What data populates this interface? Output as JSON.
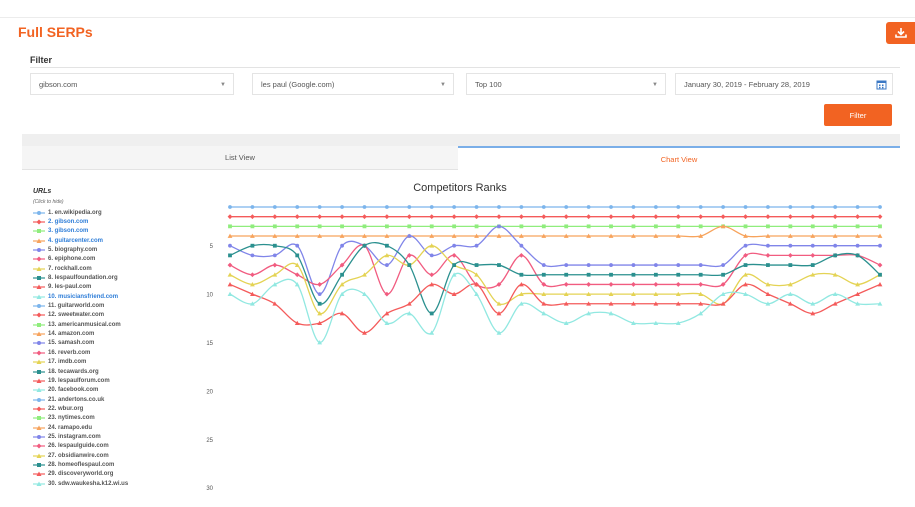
{
  "header": {
    "title": "Full SERPs"
  },
  "filter": {
    "label": "Filter",
    "domain": "gibson.com",
    "keyword": "les paul (Google.com)",
    "top": "Top 100",
    "date_range": "January 30, 2019 - February 28, 2019",
    "button": "Filter"
  },
  "tabs": {
    "list": "List View",
    "chart": "Chart View"
  },
  "legend": {
    "title": "URLs",
    "subtitle": "(Click to hide)",
    "items": [
      {
        "label": "1. en.wikipedia.org",
        "color": "#7cb5ec",
        "marker": "circle"
      },
      {
        "label": "2. gibson.com",
        "color": "#f45b5b",
        "marker": "diamond"
      },
      {
        "label": "3. gibson.com",
        "color": "#90ed7d",
        "marker": "square"
      },
      {
        "label": "4. guitarcenter.com",
        "color": "#f7a35c",
        "marker": "triangle"
      },
      {
        "label": "5. biography.com",
        "color": "#8085e9",
        "marker": "circle"
      },
      {
        "label": "6. epiphone.com",
        "color": "#f15c80",
        "marker": "diamond"
      },
      {
        "label": "7. rockhall.com",
        "color": "#e4d354",
        "marker": "triangle"
      },
      {
        "label": "8. lespaulfoundation.org",
        "color": "#2b908f",
        "marker": "square"
      },
      {
        "label": "9. les-paul.com",
        "color": "#f45b5b",
        "marker": "triangle"
      },
      {
        "label": "10. musiciansfriend.com",
        "color": "#91e8e1",
        "marker": "triangle"
      },
      {
        "label": "11. guitarworld.com",
        "color": "#7cb5ec",
        "marker": "circle"
      },
      {
        "label": "12. sweetwater.com",
        "color": "#f45b5b",
        "marker": "diamond"
      },
      {
        "label": "13. americanmusical.com",
        "color": "#90ed7d",
        "marker": "square"
      },
      {
        "label": "14. amazon.com",
        "color": "#f7a35c",
        "marker": "triangle"
      },
      {
        "label": "15. samash.com",
        "color": "#8085e9",
        "marker": "circle"
      },
      {
        "label": "16. reverb.com",
        "color": "#f15c80",
        "marker": "diamond"
      },
      {
        "label": "17. imdb.com",
        "color": "#e4d354",
        "marker": "triangle"
      },
      {
        "label": "18. tecawards.org",
        "color": "#2b908f",
        "marker": "square"
      },
      {
        "label": "19. lespaulforum.com",
        "color": "#f45b5b",
        "marker": "triangle"
      },
      {
        "label": "20. facebook.com",
        "color": "#91e8e1",
        "marker": "triangle"
      },
      {
        "label": "21. andertons.co.uk",
        "color": "#7cb5ec",
        "marker": "circle"
      },
      {
        "label": "22. wbur.org",
        "color": "#f45b5b",
        "marker": "diamond"
      },
      {
        "label": "23. nytimes.com",
        "color": "#90ed7d",
        "marker": "square"
      },
      {
        "label": "24. ramapo.edu",
        "color": "#f7a35c",
        "marker": "triangle"
      },
      {
        "label": "25. instagram.com",
        "color": "#8085e9",
        "marker": "circle"
      },
      {
        "label": "26. lespaulguide.com",
        "color": "#f15c80",
        "marker": "diamond"
      },
      {
        "label": "27. obsidianwire.com",
        "color": "#e4d354",
        "marker": "triangle"
      },
      {
        "label": "28. homeoflespaul.com",
        "color": "#2b908f",
        "marker": "square"
      },
      {
        "label": "29. discoveryworld.org",
        "color": "#f45b5b",
        "marker": "triangle"
      },
      {
        "label": "30. sdw.waukesha.k12.wi.us",
        "color": "#91e8e1",
        "marker": "triangle"
      }
    ]
  },
  "chart_data": {
    "type": "line",
    "title": "Competitors Ranks",
    "y_ticks": [
      5,
      10,
      15,
      20,
      25,
      30
    ],
    "ylim": [
      1,
      32
    ],
    "y_reversed": true,
    "point_count": 30,
    "series": [
      {
        "name": "1. en.wikipedia.org",
        "color": "#7cb5ec",
        "marker": "circle",
        "values": [
          1,
          1,
          1,
          1,
          1,
          1,
          1,
          1,
          1,
          1,
          1,
          1,
          1,
          1,
          1,
          1,
          1,
          1,
          1,
          1,
          1,
          1,
          1,
          1,
          1,
          1,
          1,
          1,
          1,
          1
        ]
      },
      {
        "name": "2. gibson.com",
        "color": "#f45b5b",
        "marker": "diamond",
        "values": [
          2,
          2,
          2,
          2,
          2,
          2,
          2,
          2,
          2,
          2,
          2,
          2,
          2,
          2,
          2,
          2,
          2,
          2,
          2,
          2,
          2,
          2,
          2,
          2,
          2,
          2,
          2,
          2,
          2,
          2
        ]
      },
      {
        "name": "3. gibson.com",
        "color": "#90ed7d",
        "marker": "square",
        "values": [
          3,
          3,
          3,
          3,
          3,
          3,
          3,
          3,
          3,
          3,
          3,
          3,
          3,
          3,
          3,
          3,
          3,
          3,
          3,
          3,
          3,
          3,
          3,
          3,
          3,
          3,
          3,
          3,
          3,
          3
        ]
      },
      {
        "name": "4. guitarcenter.com",
        "color": "#f7a35c",
        "marker": "triangle",
        "values": [
          4,
          4,
          4,
          4,
          4,
          4,
          4,
          4,
          4,
          4,
          4,
          4,
          4,
          4,
          4,
          4,
          4,
          4,
          4,
          4,
          4,
          4,
          3,
          4,
          4,
          4,
          4,
          4,
          4,
          4
        ]
      },
      {
        "name": "5. biography.com",
        "color": "#8085e9",
        "marker": "circle",
        "values": [
          5,
          6,
          6,
          5,
          10,
          5,
          5,
          7,
          4,
          6,
          5,
          5,
          3,
          5,
          7,
          7,
          7,
          7,
          7,
          7,
          7,
          7,
          7,
          5,
          5,
          5,
          5,
          5,
          5,
          5
        ]
      },
      {
        "name": "6. epiphone.com",
        "color": "#f15c80",
        "marker": "diamond",
        "values": [
          7,
          8,
          7,
          8,
          9,
          7,
          5,
          10,
          6,
          8,
          6,
          9,
          9,
          6,
          9,
          9,
          9,
          9,
          9,
          9,
          9,
          9,
          9,
          6,
          6,
          6,
          6,
          6,
          6,
          7
        ]
      },
      {
        "name": "7. rockhall.com",
        "color": "#e4d354",
        "marker": "triangle",
        "values": [
          8,
          9,
          8,
          7,
          12,
          9,
          8,
          6,
          7,
          5,
          7,
          8,
          11,
          10,
          10,
          10,
          10,
          10,
          10,
          10,
          10,
          10,
          11,
          8,
          9,
          9,
          8,
          8,
          9,
          8
        ]
      },
      {
        "name": "8. lespaulfoundation.org",
        "color": "#2b908f",
        "marker": "square",
        "values": [
          6,
          5,
          5,
          6,
          11,
          8,
          5,
          5,
          7,
          12,
          7,
          7,
          7,
          8,
          8,
          8,
          8,
          8,
          8,
          8,
          8,
          8,
          8,
          7,
          7,
          7,
          7,
          6,
          6,
          8
        ]
      },
      {
        "name": "9. les-paul.com",
        "color": "#f45b5b",
        "marker": "triangle",
        "values": [
          9,
          10,
          11,
          13,
          13,
          12,
          14,
          12,
          11,
          9,
          10,
          9,
          12,
          9,
          11,
          11,
          11,
          11,
          11,
          11,
          11,
          11,
          11,
          9,
          10,
          11,
          12,
          11,
          10,
          9
        ]
      },
      {
        "name": "10. musiciansfriend.com",
        "color": "#91e8e1",
        "marker": "triangle",
        "values": [
          10,
          11,
          9,
          9,
          15,
          10,
          10,
          13,
          12,
          14,
          8,
          10,
          14,
          11,
          12,
          13,
          12,
          12,
          13,
          13,
          13,
          12,
          10,
          10,
          11,
          10,
          11,
          10,
          11,
          11
        ]
      }
    ]
  }
}
